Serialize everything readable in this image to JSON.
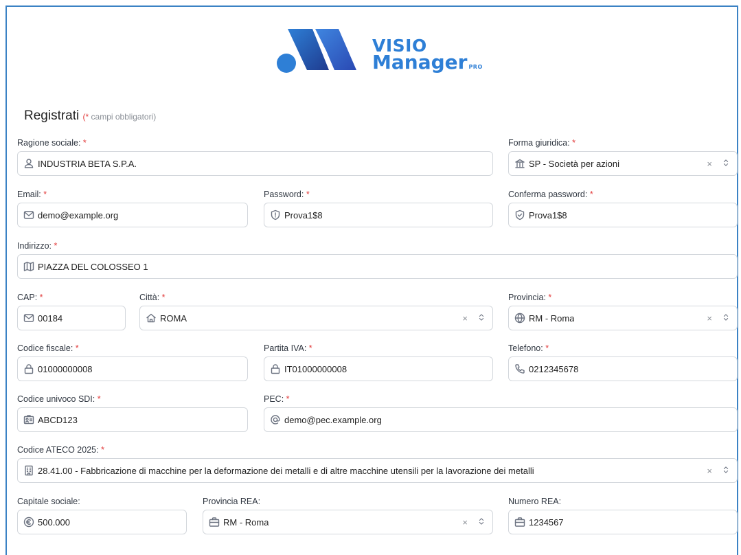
{
  "logo": {
    "line1": "VISIO",
    "line2": "Manager",
    "suffix": "PRO"
  },
  "form": {
    "title": "Registrati",
    "required_note_star": "*",
    "required_note_text": " campi obbligatori)",
    "required_note_open": "(",
    "fields": {
      "ragione_sociale": {
        "label": "Ragione sociale:",
        "value": "INDUSTRIA BETA S.P.A."
      },
      "forma_giuridica": {
        "label": "Forma giuridica:",
        "value": "SP - Società per azioni"
      },
      "email": {
        "label": "Email:",
        "value": "demo@example.org"
      },
      "password": {
        "label": "Password:",
        "value": "Prova1$8"
      },
      "conferma_password": {
        "label": "Conferma password:",
        "value": "Prova1$8"
      },
      "indirizzo": {
        "label": "Indirizzo:",
        "value": "PIAZZA DEL COLOSSEO 1"
      },
      "cap": {
        "label": "CAP:",
        "value": "00184"
      },
      "citta": {
        "label": "Città:",
        "value": "ROMA"
      },
      "provincia": {
        "label": "Provincia:",
        "value": "RM - Roma"
      },
      "codice_fiscale": {
        "label": "Codice fiscale:",
        "value": "01000000008"
      },
      "partita_iva": {
        "label": "Partita IVA:",
        "value": "IT01000000008"
      },
      "telefono": {
        "label": "Telefono:",
        "value": "0212345678"
      },
      "codice_sdi": {
        "label": "Codice univoco SDI:",
        "value": "ABCD123"
      },
      "pec": {
        "label": "PEC:",
        "value": "demo@pec.example.org"
      },
      "ateco": {
        "label": "Codice ATECO 2025:",
        "value": "28.41.00 - Fabbricazione di macchine per la deformazione dei metalli e di altre macchine utensili per la lavorazione dei metalli"
      },
      "capitale_sociale": {
        "label": "Capitale sociale:",
        "value": "500.000"
      },
      "provincia_rea": {
        "label": "Provincia REA:",
        "value": "RM - Roma"
      },
      "numero_rea": {
        "label": "Numero REA:",
        "value": "1234567"
      }
    },
    "required_star": "*",
    "clear_glyph": "×",
    "colors": {
      "accent": "#2e7fd6",
      "required": "#e23b3b",
      "border": "#d3d7dc",
      "frame": "#3b82c4"
    }
  }
}
